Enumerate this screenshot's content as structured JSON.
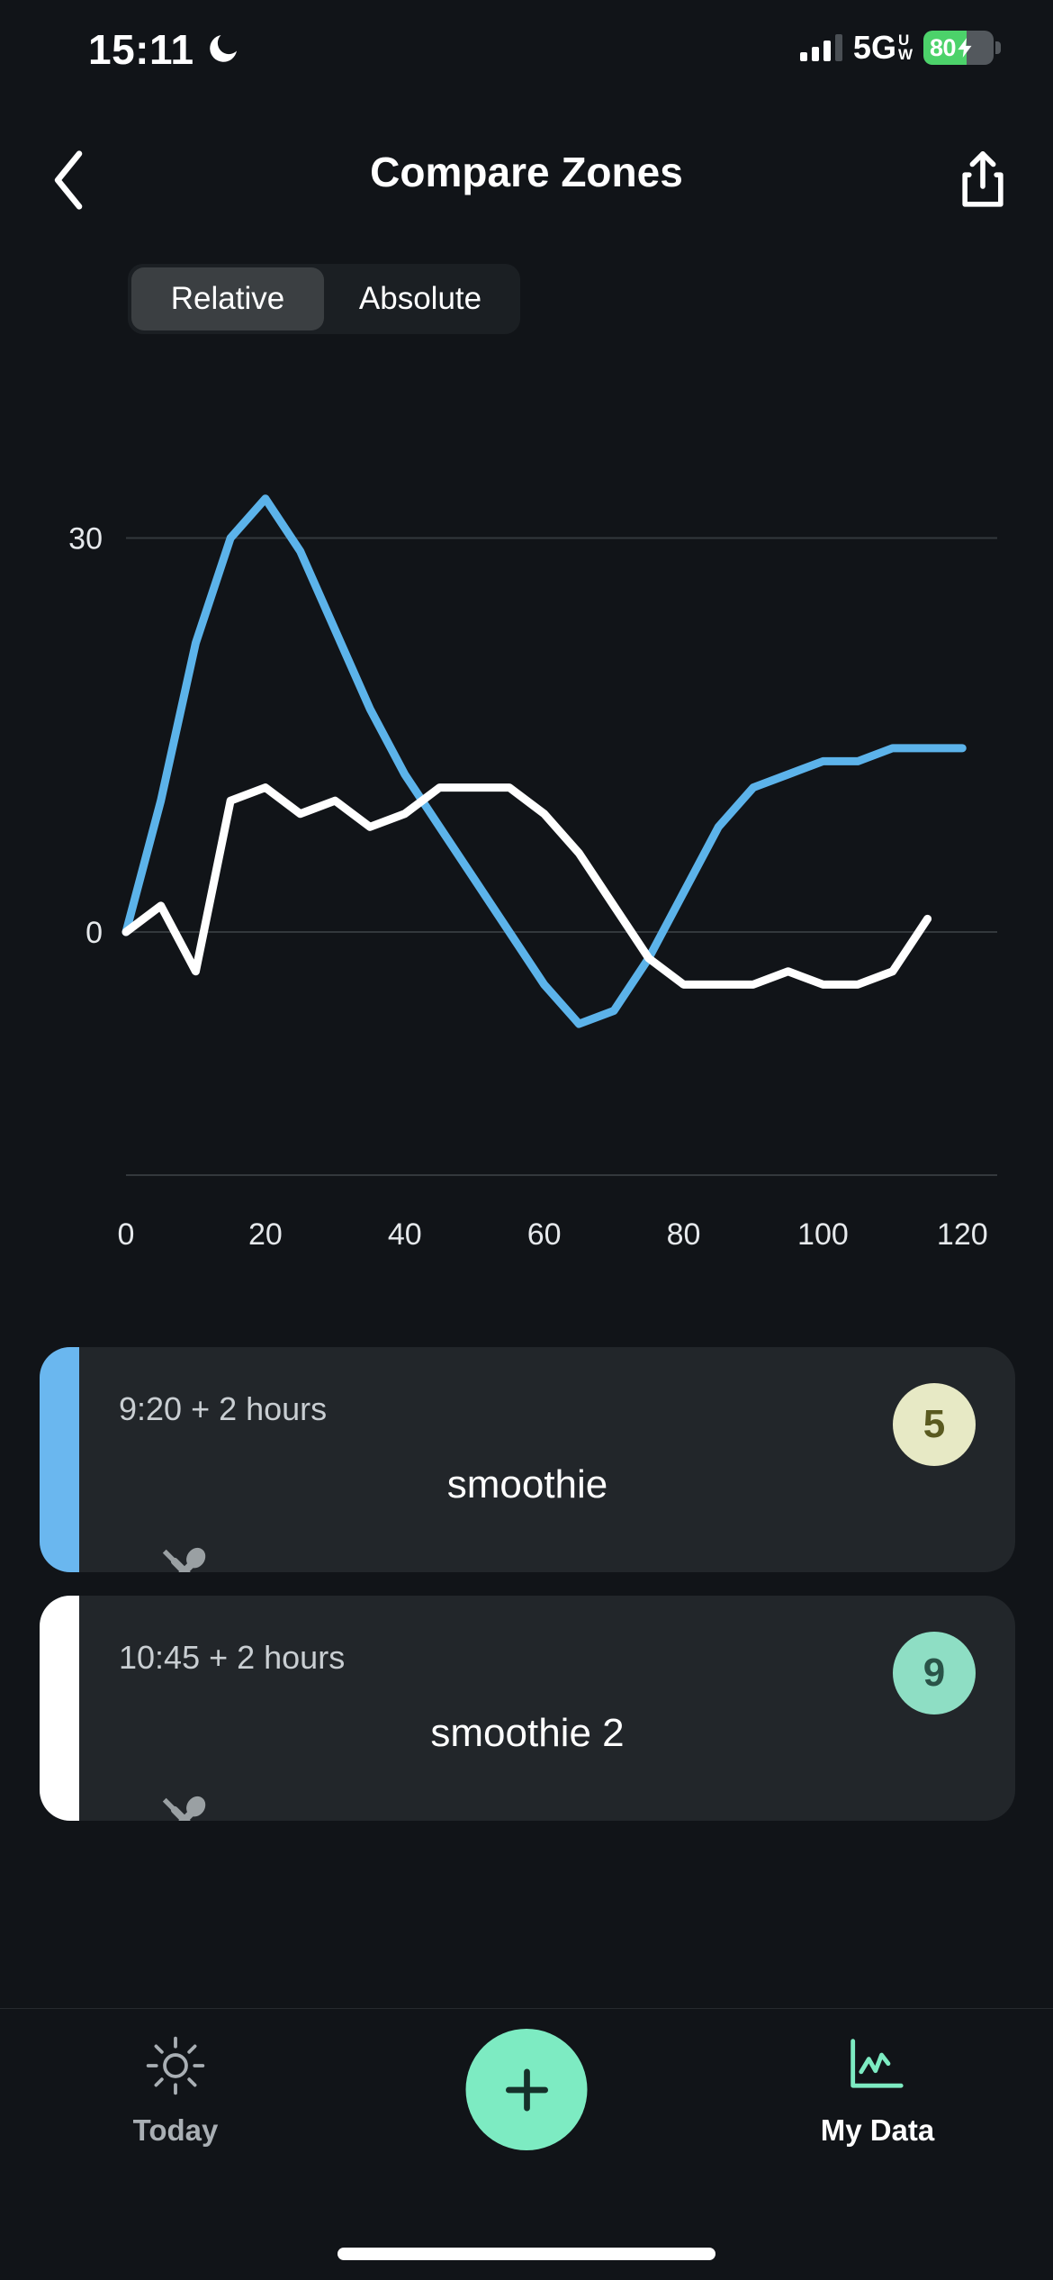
{
  "status_bar": {
    "time": "15:11",
    "dnd_icon": "moon-icon",
    "signal_icon": "cellular-signal-icon",
    "network": "5G",
    "network_suffix_top": "U",
    "network_suffix_bottom": "W",
    "battery_percent": "80",
    "battery_charging": true,
    "battery_color": "#4cd26a"
  },
  "nav": {
    "back_icon": "chevron-left-icon",
    "title": "Compare Zones",
    "share_icon": "share-icon"
  },
  "segmented": {
    "options": [
      {
        "label": "Relative",
        "selected": true
      },
      {
        "label": "Absolute",
        "selected": false
      }
    ]
  },
  "chart_data": {
    "type": "line",
    "title": "",
    "xlabel": "",
    "ylabel": "",
    "xlim": [
      0,
      125
    ],
    "ylim": [
      -12,
      36
    ],
    "grid": true,
    "gridlines_y": [
      0,
      30
    ],
    "y_ticks": [
      "0",
      "30"
    ],
    "x_ticks": [
      "0",
      "20",
      "40",
      "60",
      "80",
      "100",
      "120"
    ],
    "legend": "none",
    "series": [
      {
        "name": "smoothie",
        "color": "#5cb3ea",
        "x": [
          0,
          5,
          10,
          15,
          20,
          25,
          30,
          35,
          40,
          45,
          50,
          55,
          60,
          65,
          70,
          75,
          80,
          85,
          90,
          95,
          100,
          105,
          110,
          115,
          120
        ],
        "y": [
          0,
          10,
          22,
          30,
          33,
          29,
          23,
          17,
          12,
          8,
          4,
          0,
          -4,
          -7,
          -6,
          -2,
          3,
          8,
          11,
          12,
          13,
          13,
          14,
          14,
          14
        ]
      },
      {
        "name": "smoothie 2",
        "color": "#ffffff",
        "x": [
          0,
          5,
          10,
          15,
          20,
          25,
          30,
          35,
          40,
          45,
          50,
          55,
          60,
          65,
          70,
          75,
          80,
          85,
          90,
          95,
          100,
          105,
          110,
          115
        ],
        "y": [
          0,
          2,
          -3,
          10,
          11,
          9,
          10,
          8,
          9,
          11,
          11,
          11,
          9,
          6,
          2,
          -2,
          -4,
          -4,
          -4,
          -3,
          -4,
          -4,
          -3,
          1
        ]
      }
    ]
  },
  "cards": [
    {
      "accent_color": "#6ab7ef",
      "time": "9:20 + 2 hours",
      "name": "smoothie",
      "badge_value": "5",
      "badge_bg": "#e7e9c5",
      "badge_fg": "#5a5a20",
      "icon": "utensils-icon"
    },
    {
      "accent_color": "#ffffff",
      "time": "10:45 + 2 hours",
      "name": "smoothie 2",
      "badge_value": "9",
      "badge_bg": "#8edec4",
      "badge_fg": "#2a5348",
      "icon": "utensils-icon"
    }
  ],
  "tabbar": {
    "today": {
      "label": "Today",
      "icon": "sun-icon",
      "active": false
    },
    "add": {
      "label": "+",
      "icon": "plus-icon",
      "color": "#7debc2"
    },
    "mydata": {
      "label": "My Data",
      "icon": "chart-line-icon",
      "active": true
    }
  }
}
